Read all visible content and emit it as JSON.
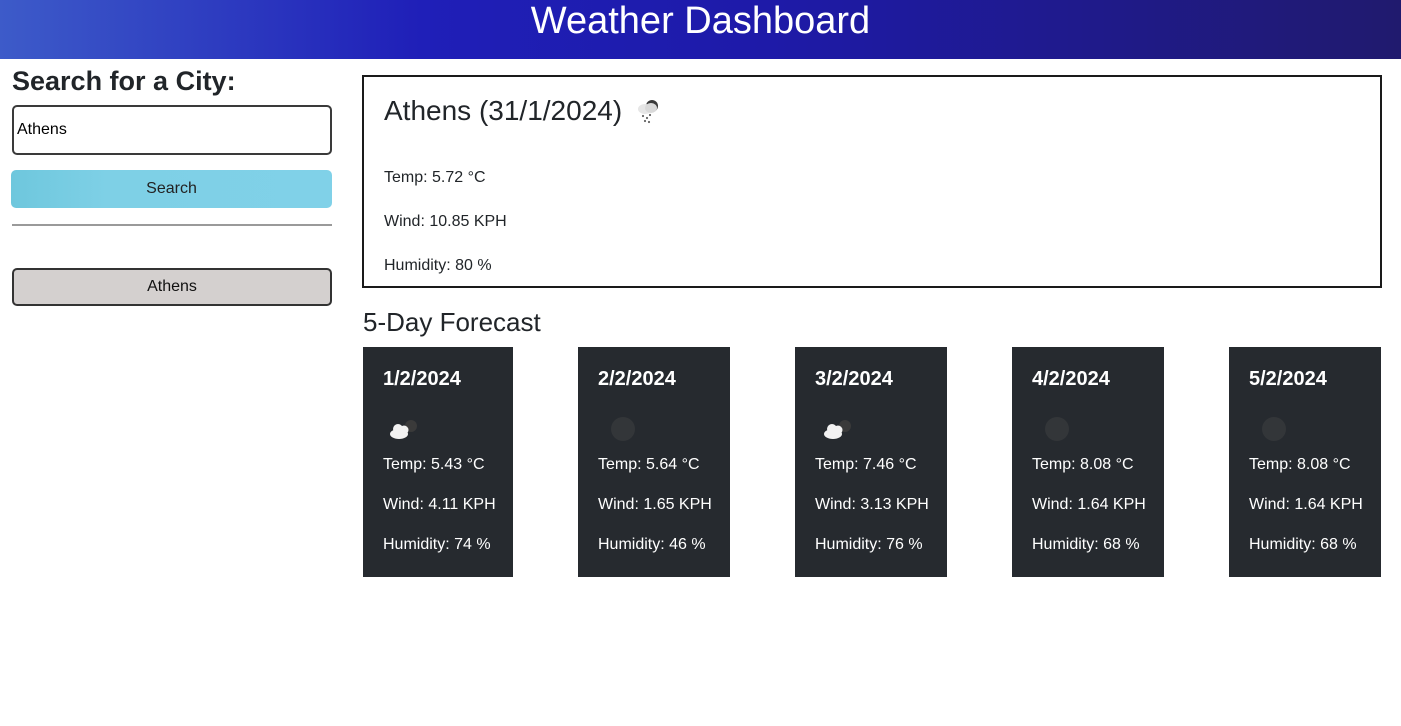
{
  "header": {
    "title": "Weather Dashboard"
  },
  "sidebar": {
    "heading": "Search for a City:",
    "search_input_value": "Athens",
    "search_button_label": "Search",
    "history": [
      "Athens"
    ]
  },
  "current": {
    "title": "Athens (31/1/2024)",
    "icon": "snow-cloud-icon",
    "temp": "Temp: 5.72 °C",
    "wind": "Wind: 10.85 KPH",
    "humidity": "Humidity: 80 %"
  },
  "forecast": {
    "heading": "5-Day Forecast",
    "days": [
      {
        "date": "1/2/2024",
        "icon": "cloudy-night-icon",
        "temp": "Temp: 5.43 °C",
        "wind": "Wind: 4.11 KPH",
        "humidity": "Humidity: 74 %"
      },
      {
        "date": "2/2/2024",
        "icon": "clear-night-icon",
        "temp": "Temp: 5.64 °C",
        "wind": "Wind: 1.65 KPH",
        "humidity": "Humidity: 46 %"
      },
      {
        "date": "3/2/2024",
        "icon": "cloudy-night-icon",
        "temp": "Temp: 7.46 °C",
        "wind": "Wind: 3.13 KPH",
        "humidity": "Humidity: 76 %"
      },
      {
        "date": "4/2/2024",
        "icon": "clear-night-icon",
        "temp": "Temp: 8.08 °C",
        "wind": "Wind: 1.64 KPH",
        "humidity": "Humidity: 68 %"
      },
      {
        "date": "5/2/2024",
        "icon": "clear-night-icon",
        "temp": "Temp: 8.08 °C",
        "wind": "Wind: 1.64 KPH",
        "humidity": "Humidity: 68 %"
      }
    ]
  },
  "colors": {
    "header_gradient_start": "#3d5bc9",
    "header_gradient_end": "#201a6e",
    "search_button": "#80d1e8",
    "history_button": "#d4d0cf",
    "forecast_card": "#262a2f"
  }
}
